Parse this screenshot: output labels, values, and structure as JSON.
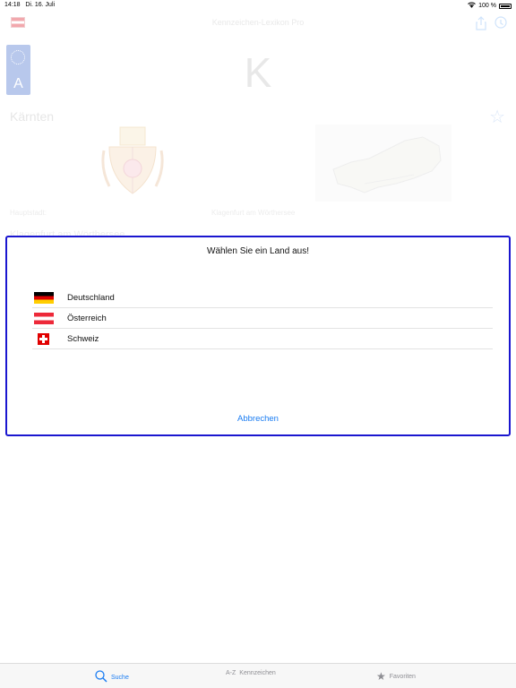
{
  "status": {
    "time": "14:18",
    "date": "Di. 16. Juli",
    "battery": "100 %"
  },
  "nav": {
    "title": "Kennzeichen-Lexikon Pro",
    "icons": [
      "share-icon",
      "info-icon"
    ]
  },
  "plate": {
    "letter": "A"
  },
  "entry": {
    "code": "K",
    "region": "Kärnten",
    "capital_label": "Hauptstadt:",
    "capital_value": "Klagenfurt am Wörthersee",
    "next_heading": "Klagenfurt am Wörthersee"
  },
  "dialog": {
    "title": "Wählen Sie ein Land aus!",
    "countries": [
      {
        "name": "Deutschland",
        "flag": "flag-de"
      },
      {
        "name": "Österreich",
        "flag": "flag-at"
      },
      {
        "name": "Schweiz",
        "flag": "flag-ch"
      }
    ],
    "cancel": "Abbrechen"
  },
  "tabs": [
    {
      "label": "Suche",
      "icon": "search-icon",
      "active": true
    },
    {
      "label": "Kennzeichen",
      "icon": "az-icon",
      "prefix": "A-Z",
      "active": false
    },
    {
      "label": "Favoriten",
      "icon": "star-icon",
      "active": false
    }
  ],
  "colors": {
    "accent": "#1a7cf2",
    "dialog_border": "#1a16cf"
  }
}
